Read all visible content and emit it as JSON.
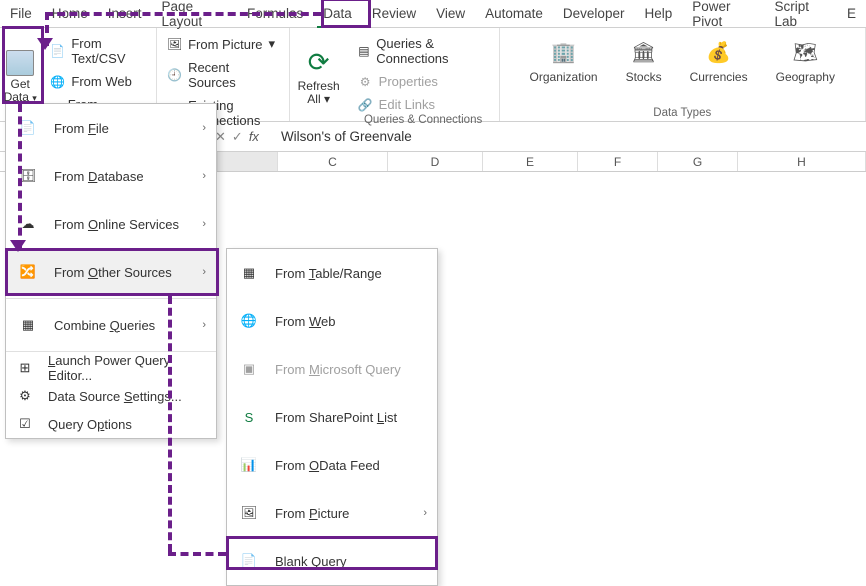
{
  "tabs": [
    "File",
    "Home",
    "Insert",
    "Page Layout",
    "Formulas",
    "Data",
    "Review",
    "View",
    "Automate",
    "Developer",
    "Help",
    "Power Pivot",
    "Script Lab",
    "E"
  ],
  "active_tab": "Data",
  "ribbon": {
    "get_data": {
      "label": "Get\nData",
      "chev": "▾"
    },
    "src_left": [
      {
        "label": "From Text/CSV"
      },
      {
        "label": "From Web"
      },
      {
        "label": "From Table/Range"
      }
    ],
    "src_right": [
      {
        "label": "From Picture",
        "chev": "▾"
      },
      {
        "label": "Recent Sources"
      },
      {
        "label": "Existing Connections"
      }
    ],
    "refresh": {
      "label": "Refresh\nAll",
      "chev": "▾"
    },
    "qc": [
      {
        "label": "Queries & Connections",
        "enabled": true
      },
      {
        "label": "Properties",
        "enabled": false
      },
      {
        "label": "Edit Links",
        "enabled": false
      }
    ],
    "qc_group_label": "Queries & Connections",
    "datatypes": [
      {
        "label": "Organization",
        "icon": "🏢"
      },
      {
        "label": "Stocks",
        "icon": "🏛"
      },
      {
        "label": "Currencies",
        "icon": "💰"
      },
      {
        "label": "Geography",
        "icon": "🗺"
      }
    ],
    "dt_group_label": "Data Types"
  },
  "formula_bar": {
    "value": "Wilson's of Greenvale"
  },
  "columns": [
    "C",
    "D",
    "E",
    "F",
    "G",
    "H"
  ],
  "menu1": {
    "items": [
      {
        "key": "from-file",
        "label": "From File",
        "accel": "F",
        "arrow": true
      },
      {
        "key": "from-database",
        "label": "From Database",
        "accel": "D",
        "arrow": true
      },
      {
        "key": "from-online-services",
        "label": "From Online Services",
        "accel": "O",
        "arrow": true
      },
      {
        "key": "from-other-sources",
        "label": "From Other Sources",
        "accel": "O",
        "arrow": true,
        "hover": true
      },
      {
        "key": "combine-queries",
        "label": "Combine Queries",
        "accel": "Q",
        "arrow": true
      }
    ],
    "small_items": [
      {
        "key": "launch-pq",
        "label": "Launch Power Query Editor...",
        "accel": "L"
      },
      {
        "key": "data-source-settings",
        "label": "Data Source Settings...",
        "accel": "S"
      },
      {
        "key": "query-options",
        "label": "Query Options",
        "accel": "P"
      }
    ]
  },
  "menu2": {
    "items": [
      {
        "key": "from-table-range",
        "label": "From Table/Range",
        "accel": "T"
      },
      {
        "key": "from-web",
        "label": "From Web",
        "accel": "W"
      },
      {
        "key": "from-ms-query",
        "label": "From Microsoft Query",
        "accel": "M",
        "dim": true
      },
      {
        "key": "from-sharepoint-list",
        "label": "From SharePoint List",
        "accel": "L"
      },
      {
        "key": "from-odata-feed",
        "label": "From OData Feed",
        "accel": "O"
      },
      {
        "key": "from-picture",
        "label": "From Picture",
        "accel": "P",
        "arrow": true
      },
      {
        "key": "blank-query",
        "label": "Blank Query",
        "accel": "Q"
      }
    ]
  }
}
